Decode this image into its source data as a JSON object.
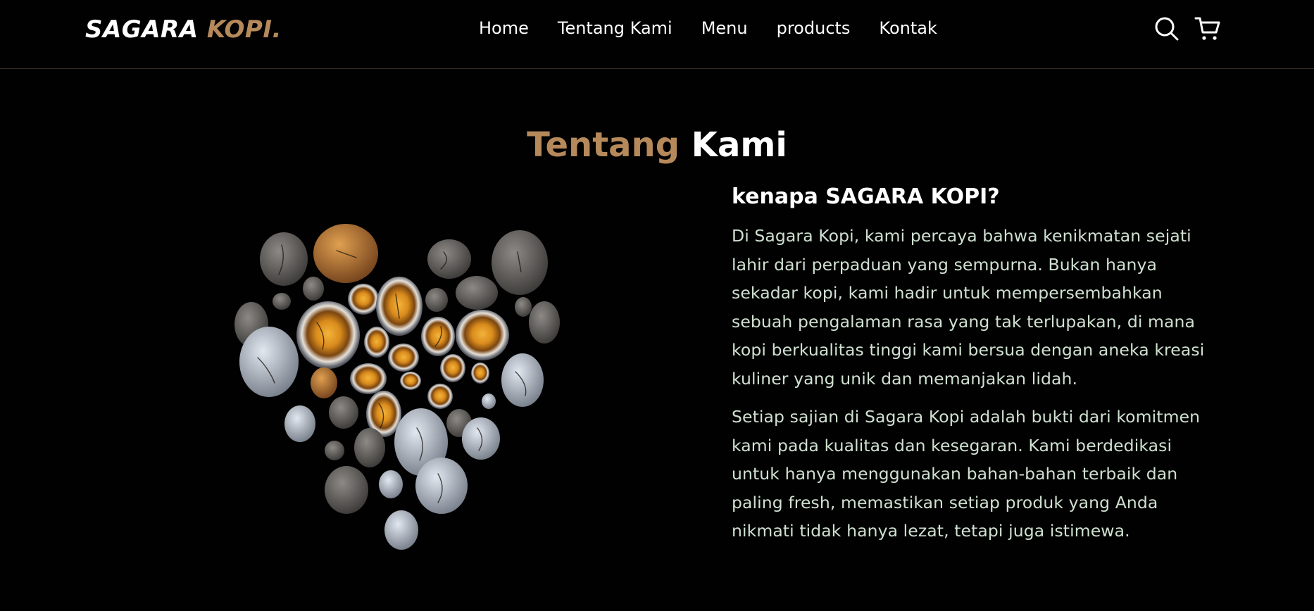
{
  "brand": {
    "name_white": "SAGARA ",
    "name_brown": "KOPI.",
    "accent_color": "#b6895b"
  },
  "nav": {
    "items": [
      {
        "label": "Home"
      },
      {
        "label": "Tentang Kami"
      },
      {
        "label": "Menu"
      },
      {
        "label": "products"
      },
      {
        "label": "Kontak"
      }
    ],
    "icons": [
      "search-icon",
      "shopping-cart-icon"
    ]
  },
  "about": {
    "title_brown": "Tentang",
    "title_white": " Kami",
    "heading": "kenapa SAGARA KOPI?",
    "paragraphs": [
      "Di Sagara Kopi, kami percaya bahwa kenikmatan sejati lahir dari perpaduan yang sempurna. Bukan hanya sekadar kopi, kami hadir untuk mempersembahkan sebuah pengalaman rasa yang tak terlupakan, di mana kopi berkualitas tinggi kami bersua dengan aneka kreasi kuliner yang unik dan memanjakan lidah.",
      "Setiap sajian di Sagara Kopi adalah bukti dari komitmen kami pada kualitas dan kesegaran. Kami berdedikasi untuk hanya menggunakan bahan-bahan terbaik dan paling fresh, memastikan setiap produk yang Anda nikmati tidak hanya lezat, tetapi juga istimewa."
    ]
  }
}
